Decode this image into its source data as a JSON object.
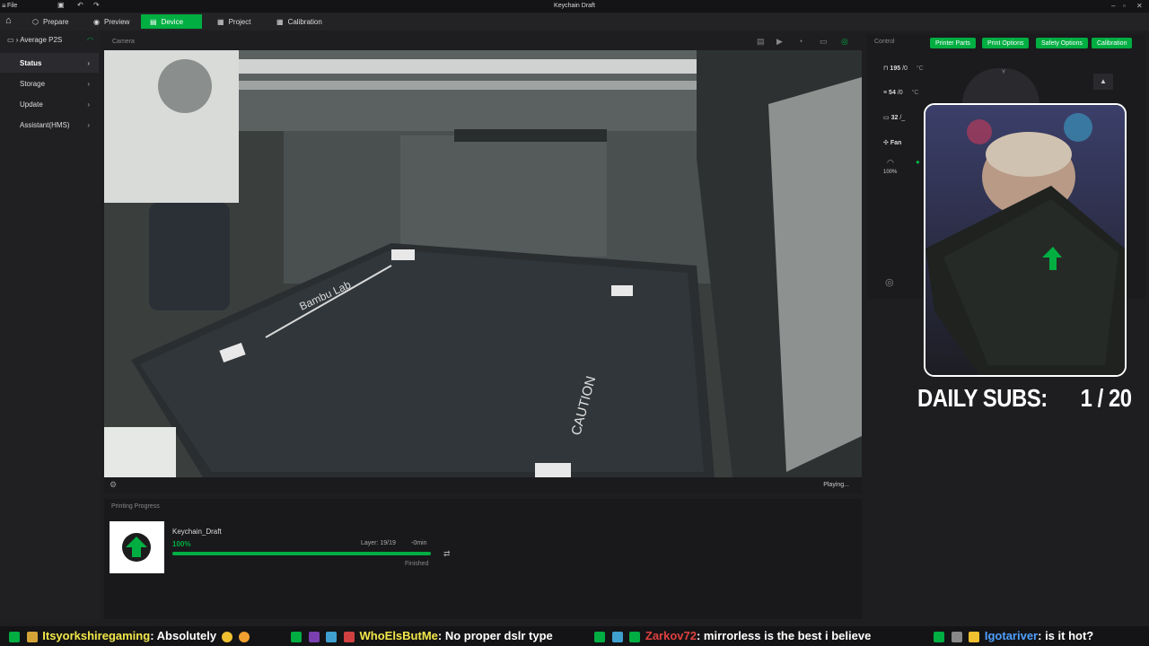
{
  "window": {
    "title": "Keychain Draft",
    "file_menu": "File"
  },
  "nav": {
    "tabs": [
      {
        "label": "Prepare"
      },
      {
        "label": "Preview"
      },
      {
        "label": "Device"
      },
      {
        "label": "Project"
      },
      {
        "label": "Calibration"
      }
    ]
  },
  "sidebar": {
    "printer": "Average P2S",
    "items": [
      {
        "label": "Status"
      },
      {
        "label": "Storage"
      },
      {
        "label": "Update"
      },
      {
        "label": "Assistant(HMS)"
      }
    ]
  },
  "camera": {
    "header": "Camera",
    "status": "Playing..."
  },
  "progress": {
    "header": "Printing Progress",
    "job_name": "Keychain_Draft",
    "percent_label": "100%",
    "percent": 100,
    "layer": "Layer: 19/19",
    "remaining": "-0min",
    "state": "Finished"
  },
  "control": {
    "header": "Control",
    "buttons": [
      {
        "label": "Printer Parts"
      },
      {
        "label": "Print Options"
      },
      {
        "label": "Safety Options"
      },
      {
        "label": "Calibration"
      }
    ],
    "temps": [
      {
        "value": "195",
        "target": "/0",
        "unit": "°C"
      },
      {
        "value": "54",
        "target": "/0",
        "unit": "°C"
      },
      {
        "value": "32",
        "target": "/_",
        "unit": ""
      }
    ],
    "fan_label": "Fan",
    "fan_speed": "100%"
  },
  "overlay": {
    "daily_subs_label": "DAILY SUBS:",
    "daily_subs_count": "1 / 20"
  },
  "chat": [
    {
      "user": "Itsyorkshiregaming",
      "message": ": Absolutely"
    },
    {
      "user": "WhoElsButMe",
      "message": ": No proper dslr type"
    },
    {
      "user": "Zarkov72",
      "message": ": mirrorless is the best i believe"
    },
    {
      "user": "Igotariver",
      "message": ": is it hot?"
    }
  ],
  "colors": {
    "accent": "#00ae42",
    "chat_name": "#f2e84a",
    "panel": "#1b1b1d"
  }
}
